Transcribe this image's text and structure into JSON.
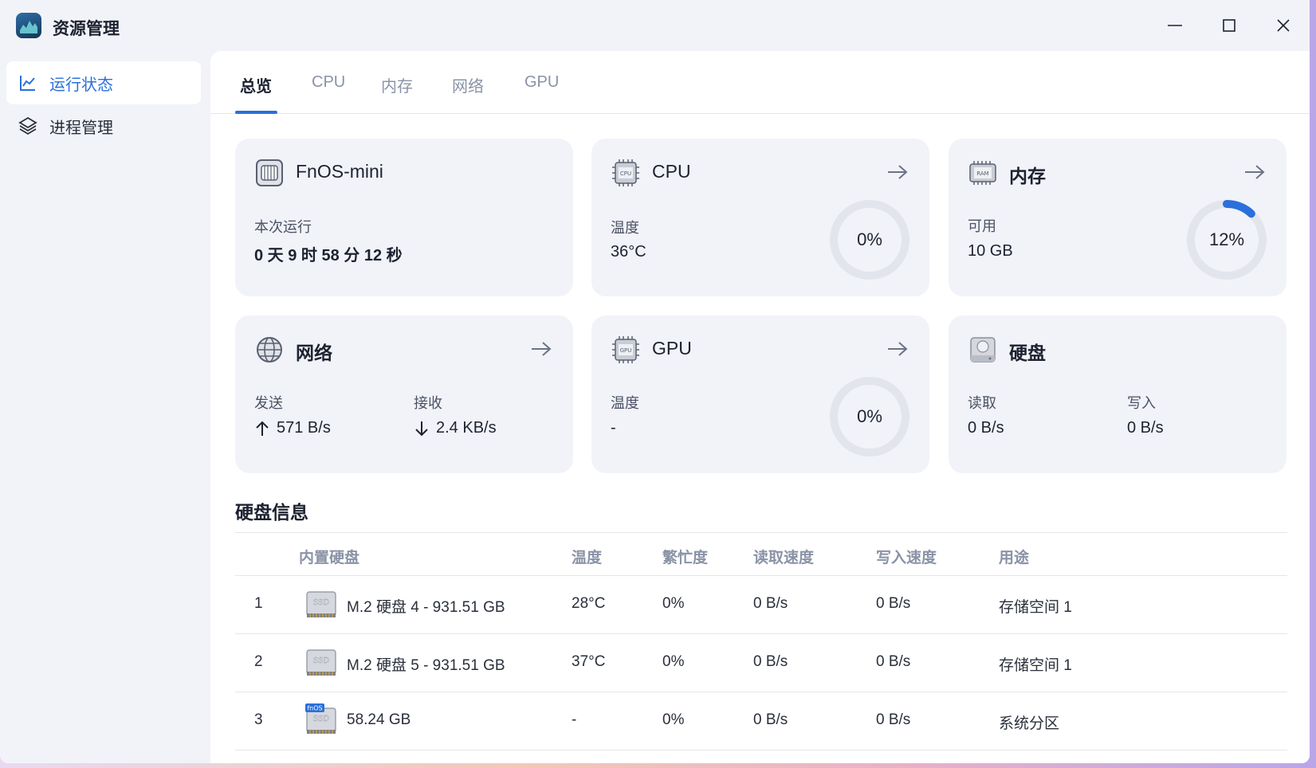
{
  "app": {
    "title": "资源管理"
  },
  "sidebar": {
    "items": [
      {
        "label": "运行状态",
        "icon": "chart-line-icon",
        "active": true
      },
      {
        "label": "进程管理",
        "icon": "layers-icon",
        "active": false
      }
    ]
  },
  "tabs": [
    "总览",
    "CPU",
    "内存",
    "网络",
    "GPU"
  ],
  "active_tab": "总览",
  "cards": {
    "system": {
      "title": "FnOS-mini",
      "label": "本次运行",
      "uptime": "0 天 9 时 58 分 12 秒"
    },
    "cpu": {
      "title": "CPU",
      "label": "温度",
      "value": "36°C",
      "usage": "0%",
      "usage_fraction": 0.0
    },
    "memory": {
      "title": "内存",
      "label": "可用",
      "value": "10 GB",
      "usage": "12%",
      "usage_fraction": 0.12
    },
    "network": {
      "title": "网络",
      "send_label": "发送",
      "send_value": "571 B/s",
      "recv_label": "接收",
      "recv_value": "2.4 KB/s"
    },
    "gpu": {
      "title": "GPU",
      "label": "温度",
      "value": "-",
      "usage": "0%",
      "usage_fraction": 0.0
    },
    "disk": {
      "title": "硬盘",
      "read_label": "读取",
      "read_value": "0 B/s",
      "write_label": "写入",
      "write_value": "0 B/s"
    }
  },
  "disk_info": {
    "title": "硬盘信息",
    "columns": [
      "内置硬盘",
      "温度",
      "繁忙度",
      "读取速度",
      "写入速度",
      "用途"
    ],
    "rows": [
      {
        "index": "1",
        "name": "M.2 硬盘 4 - 931.51 GB",
        "temp": "28°C",
        "busy": "0%",
        "read": "0 B/s",
        "write": "0 B/s",
        "usage": "存储空间 1",
        "badge": "SSD",
        "system_badge": ""
      },
      {
        "index": "2",
        "name": "M.2 硬盘 5 - 931.51 GB",
        "temp": "37°C",
        "busy": "0%",
        "read": "0 B/s",
        "write": "0 B/s",
        "usage": "存储空间 1",
        "badge": "SSD",
        "system_badge": ""
      },
      {
        "index": "3",
        "name": "58.24 GB",
        "temp": "-",
        "busy": "0%",
        "read": "0 B/s",
        "write": "0 B/s",
        "usage": "系统分区",
        "badge": "SSD",
        "system_badge": "fnOS"
      }
    ]
  },
  "colors": {
    "accent": "#2a6fdb",
    "card_bg": "#f1f3f8",
    "muted": "#8a93a6"
  }
}
